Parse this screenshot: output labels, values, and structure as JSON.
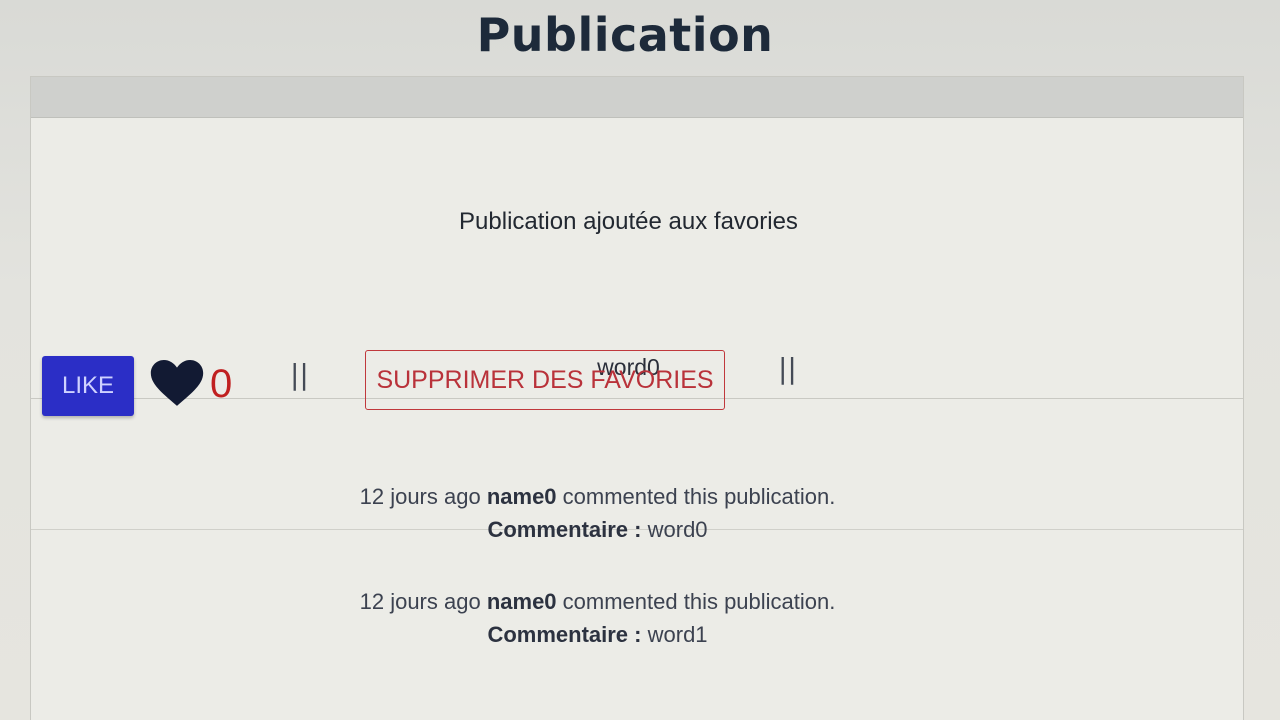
{
  "page": {
    "title": "Publication"
  },
  "publication": {
    "flash_message": "Publication ajoutée aux favories",
    "content": "word0"
  },
  "actions": {
    "like_label": "LIKE",
    "like_count": "0",
    "separator": "||",
    "remove_favorite_label": "SUPPRIMER DES FAVORIES"
  },
  "comments": [
    {
      "time": "12 jours ago",
      "author": "name0",
      "action": "commented this publication.",
      "label": "Commentaire :",
      "text": "word0"
    },
    {
      "time": "12 jours ago",
      "author": "name0",
      "action": "commented this publication.",
      "label": "Commentaire :",
      "text": "word1"
    }
  ],
  "colors": {
    "like_button": "#2b2ec6",
    "like_count": "#c02020",
    "remove_button_border": "#c0383c",
    "heart": "#121a33"
  },
  "icons": {
    "heart": "heart-icon"
  }
}
